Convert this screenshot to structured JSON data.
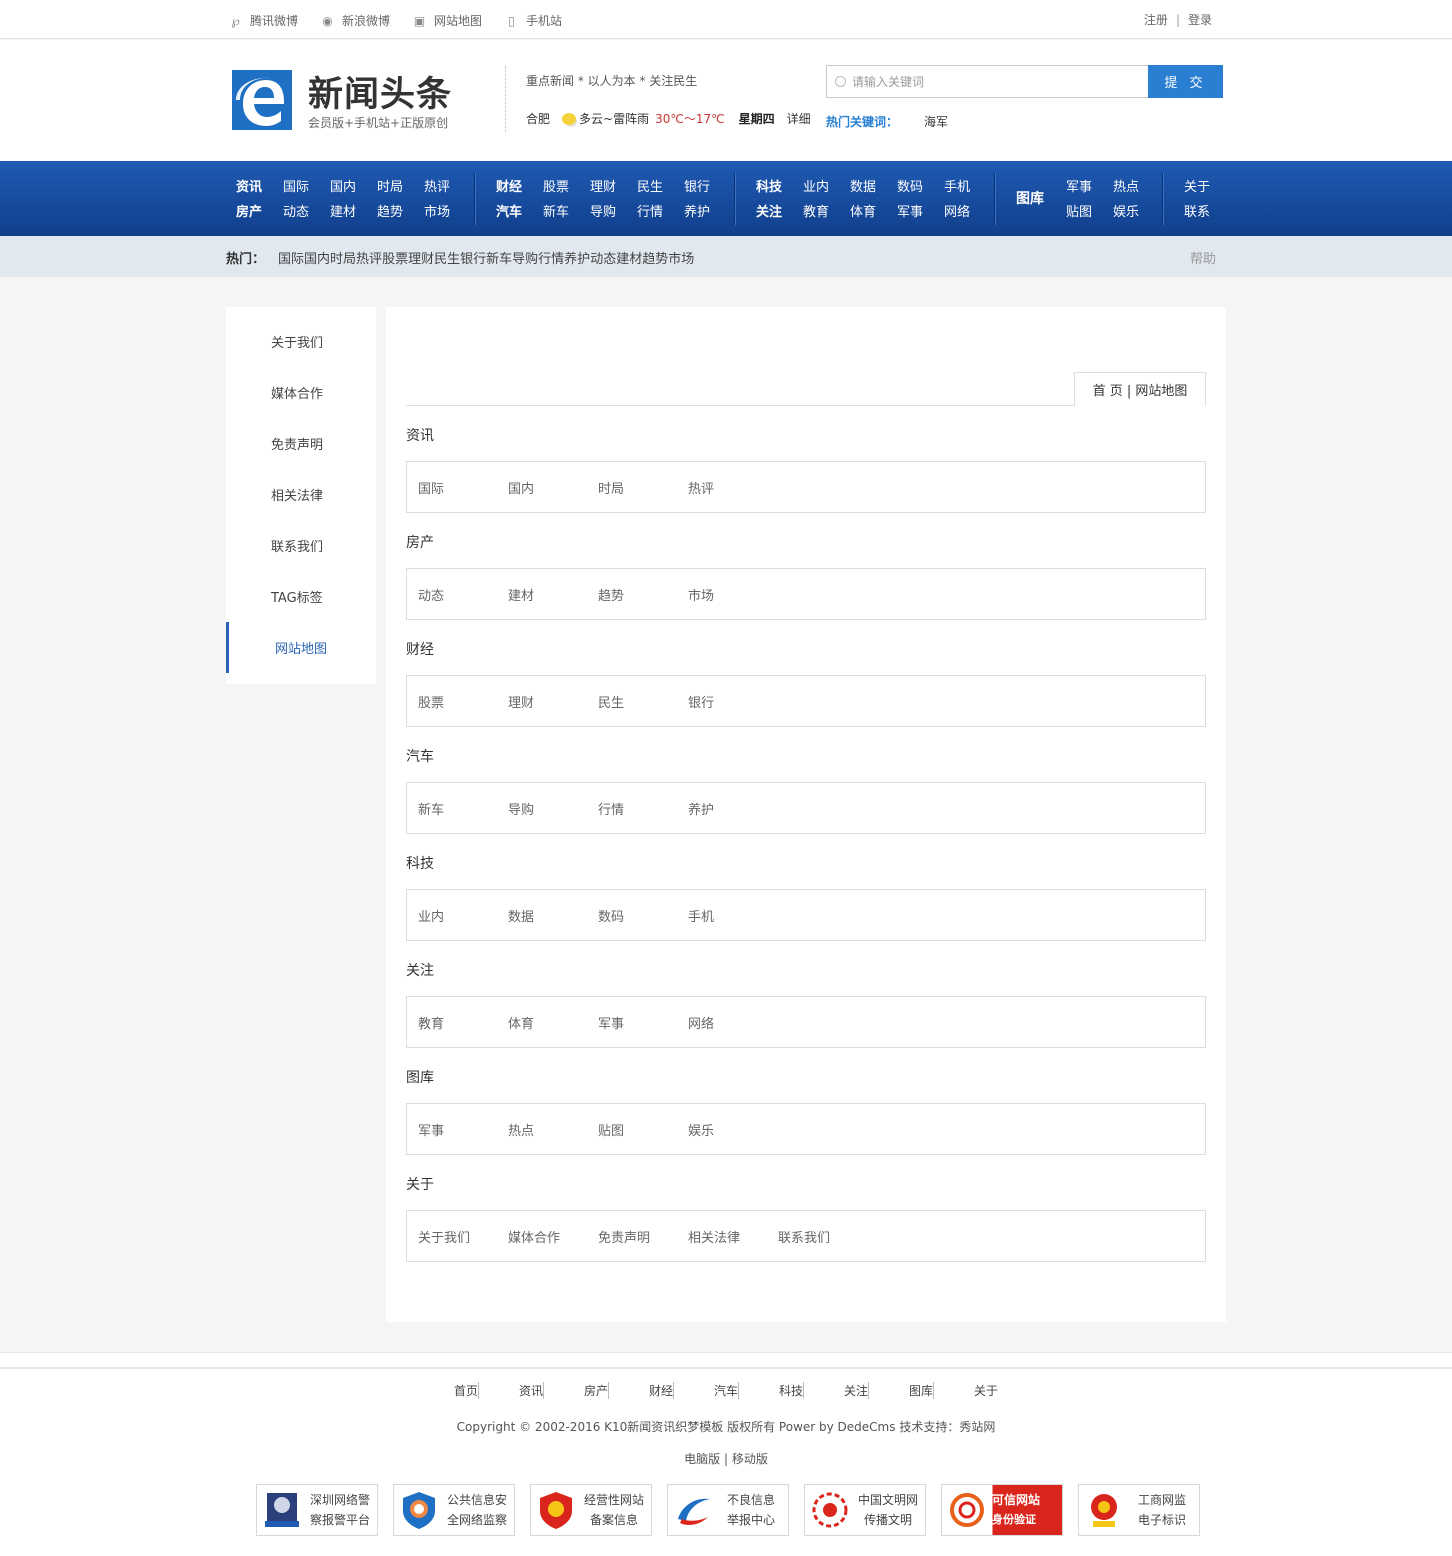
{
  "topbar": {
    "links": [
      {
        "label": "腾讯微博",
        "icon": "tencent-weibo-icon"
      },
      {
        "label": "新浪微博",
        "icon": "sina-weibo-icon"
      },
      {
        "label": "网站地图",
        "icon": "rss-icon"
      },
      {
        "label": "手机站",
        "icon": "mobile-icon"
      }
    ],
    "register": "注册",
    "separator": "|",
    "login": "登录"
  },
  "header": {
    "logo_title": "新闻头条",
    "logo_sub": "会员版+手机站+正版原创",
    "slogan": "重点新闻 * 以人为本 * 关注民生",
    "weather": {
      "city": "合肥",
      "desc": "多云~雷阵雨",
      "temp": "30℃～17℃",
      "weekday": "星期四",
      "more": "详细"
    },
    "search": {
      "placeholder": "请输入关键词",
      "button": "提 交"
    },
    "hot_keywords_label": "热门关键词：",
    "hot_keyword": "海军"
  },
  "nav": {
    "group1": {
      "row1": [
        "资讯",
        "国际",
        "国内",
        "时局",
        "热评"
      ],
      "row2": [
        "房产",
        "动态",
        "建材",
        "趋势",
        "市场"
      ]
    },
    "group2": {
      "row1": [
        "财经",
        "股票",
        "理财",
        "民生",
        "银行"
      ],
      "row2": [
        "汽车",
        "新车",
        "导购",
        "行情",
        "养护"
      ]
    },
    "group3": {
      "row1": [
        "科技",
        "业内",
        "数据",
        "数码",
        "手机"
      ],
      "row2": [
        "关注",
        "教育",
        "体育",
        "军事",
        "网络"
      ]
    },
    "group4": {
      "head": "图库",
      "row1": [
        "军事",
        "热点"
      ],
      "row2": [
        "贴图",
        "娱乐"
      ]
    },
    "group5": {
      "row1": "关于",
      "row2": "联系"
    }
  },
  "hotbar": {
    "label": "热门：",
    "items": [
      "国际",
      "国内",
      "时局",
      "热评",
      "股票",
      "理财",
      "民生",
      "银行",
      "新车",
      "导购",
      "行情",
      "养护",
      "动态",
      "建材",
      "趋势",
      "市场"
    ],
    "help": "帮助"
  },
  "sidebar": {
    "items": [
      "关于我们",
      "媒体合作",
      "免责声明",
      "相关法律",
      "联系我们",
      "TAG标签",
      "网站地图"
    ]
  },
  "breadcrumb": "首 页 | 网站地图",
  "sitemap": [
    {
      "title": "资讯",
      "links": [
        "国际",
        "国内",
        "时局",
        "热评"
      ]
    },
    {
      "title": "房产",
      "links": [
        "动态",
        "建材",
        "趋势",
        "市场"
      ]
    },
    {
      "title": "财经",
      "links": [
        "股票",
        "理财",
        "民生",
        "银行"
      ]
    },
    {
      "title": "汽车",
      "links": [
        "新车",
        "导购",
        "行情",
        "养护"
      ]
    },
    {
      "title": "科技",
      "links": [
        "业内",
        "数据",
        "数码",
        "手机"
      ]
    },
    {
      "title": "关注",
      "links": [
        "教育",
        "体育",
        "军事",
        "网络"
      ]
    },
    {
      "title": "图库",
      "links": [
        "军事",
        "热点",
        "贴图",
        "娱乐"
      ]
    },
    {
      "title": "关于",
      "links": [
        "关于我们",
        "媒体合作",
        "免责声明",
        "相关法律",
        "联系我们"
      ]
    }
  ],
  "footer": {
    "nav": [
      "首页",
      "资讯",
      "房产",
      "财经",
      "汽车",
      "科技",
      "关注",
      "图库",
      "关于"
    ],
    "copyright": "Copyright © 2002-2016 K10新闻资讯织梦模板 版权所有 Power by DedeCms  技术支持：秀站网",
    "version": "电脑版 | 移动版",
    "badges": [
      {
        "l1": "深圳网络警",
        "l2": "察报警平台"
      },
      {
        "l1": "公共信息安",
        "l2": "全网络监察"
      },
      {
        "l1": "经营性网站",
        "l2": "备案信息"
      },
      {
        "l1": "不良信息",
        "l2": "举报中心"
      },
      {
        "l1": "中国文明网",
        "l2": "传播文明"
      },
      {
        "l1": "可信网站",
        "l2": "身份验证"
      },
      {
        "l1": "工商网监",
        "l2": "电子标识"
      }
    ]
  }
}
